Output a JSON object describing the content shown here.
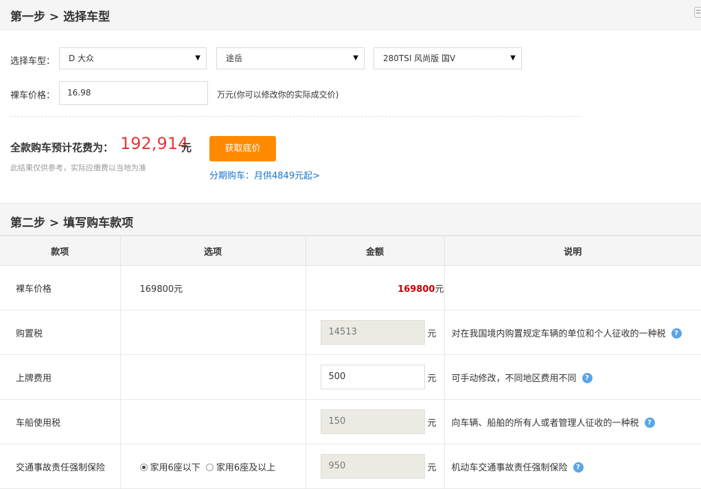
{
  "step1": {
    "title": "第一步 > 选择车型",
    "select_label": "选择车型：",
    "brand": "D 大众",
    "model": "途岳",
    "trim": "280TSI 风尚版 国V",
    "price_label": "裸车价格：",
    "price_value": "16.98",
    "price_hint": "万元(你可以修改你的实际成交价)",
    "total_label": "全款购车预计花费为：",
    "total_value": "192,914",
    "total_unit": "元",
    "disclaimer": "此结果仅供参考，实际应缴费以当地为准",
    "get_price_button": "获取底价",
    "installment_link": "分期购车：月供4849元起>"
  },
  "step2": {
    "title": "第二步 > 填写购车款项",
    "columns": [
      "款项",
      "选项",
      "金额",
      "说明"
    ],
    "rows": [
      {
        "name": "裸车价格",
        "option": "169800元",
        "amount": "169800",
        "unit": "元",
        "note": ""
      },
      {
        "name": "购置税",
        "option": "",
        "amount": "14513",
        "unit": "元",
        "note": "对在我国境内购置规定车辆的单位和个人征收的一种税"
      },
      {
        "name": "上牌费用",
        "option": "",
        "amount": "500",
        "unit": "元",
        "note": "可手动修改，不同地区费用不同"
      },
      {
        "name": "车船使用税",
        "option": "",
        "amount": "150",
        "unit": "元",
        "note": "向车辆、船舶的所有人或者管理人征收的一种税"
      },
      {
        "name": "交通事故责任强制保险",
        "option_a": "家用6座以下",
        "option_b": "家用6座及以上",
        "amount": "950",
        "unit": "元",
        "note": "机动车交通事故责任强制保险"
      }
    ]
  },
  "icons": {
    "help": "?",
    "caret": "▼"
  },
  "colors": {
    "accent_orange": "#ff8a00",
    "total_red": "#e4393c",
    "price_red": "#c00000",
    "link_blue": "#1a73c9",
    "help_blue": "#5aa5e8"
  }
}
